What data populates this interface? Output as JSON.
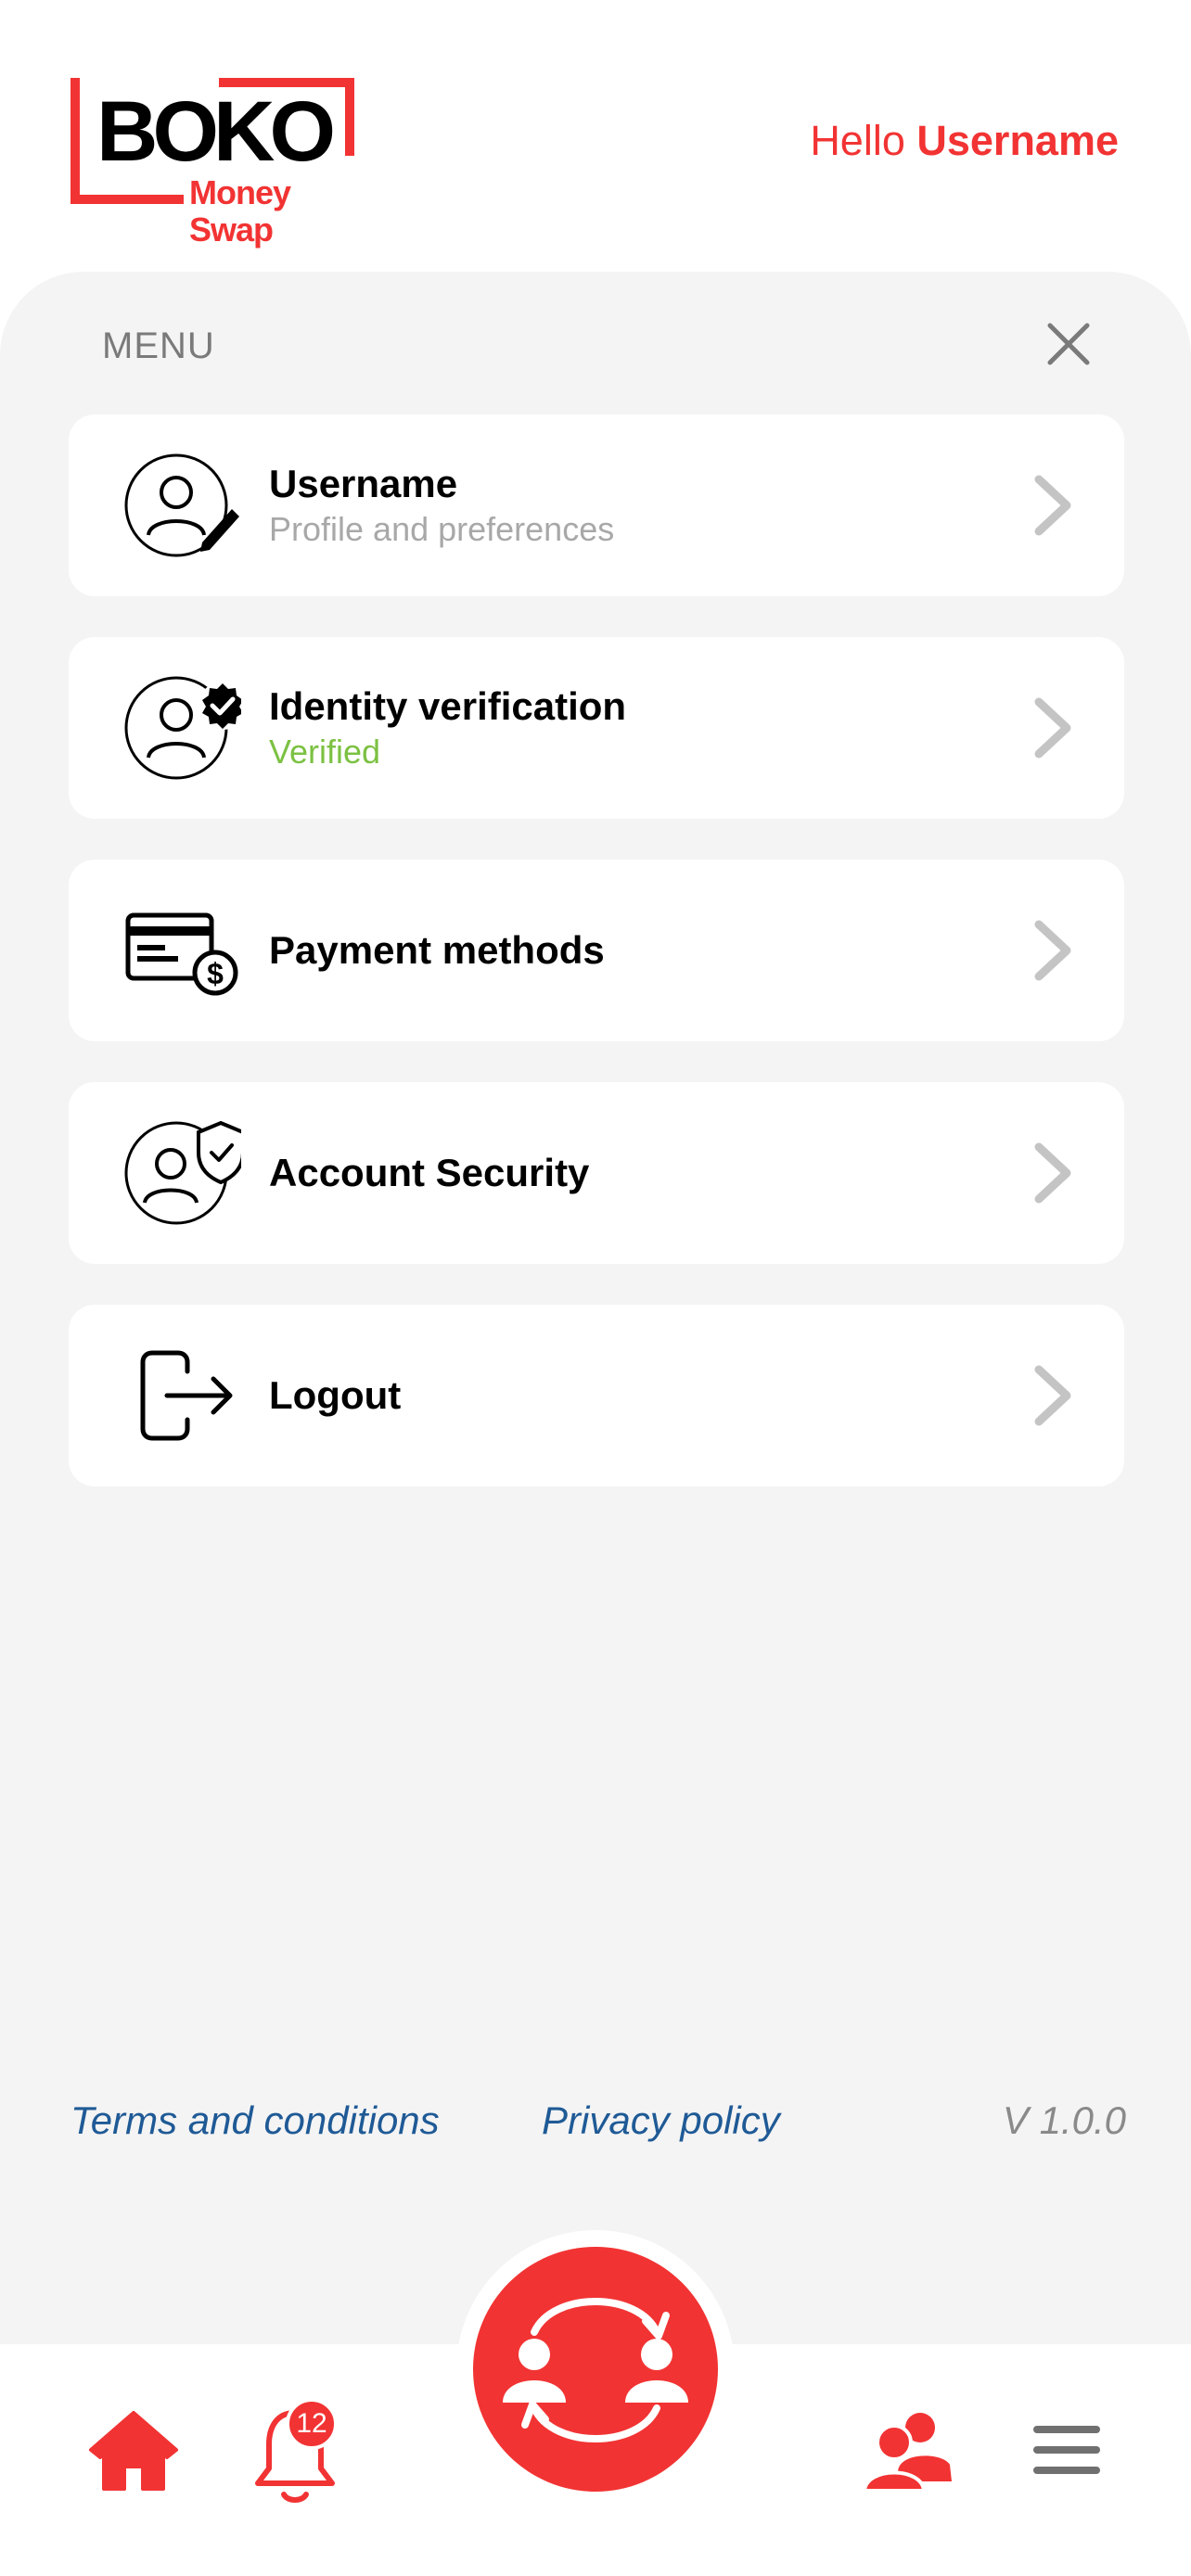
{
  "header": {
    "logo_text": "BOKO",
    "logo_sub": "Money Swap",
    "greeting_prefix": "Hello ",
    "greeting_name": "Username"
  },
  "menu": {
    "title": "MENU",
    "items": [
      {
        "icon": "user-edit-icon",
        "title": "Username",
        "subtitle": "Profile and preferences"
      },
      {
        "icon": "user-verified-icon",
        "title": "Identity verification",
        "subtitle": "Verified"
      },
      {
        "icon": "payment-card-icon",
        "title": "Payment methods"
      },
      {
        "icon": "user-shield-icon",
        "title": "Account Security"
      },
      {
        "icon": "logout-icon",
        "title": "Logout"
      }
    ]
  },
  "footer": {
    "terms": "Terms and conditions",
    "privacy": "Privacy policy",
    "version": "V 1.0.0"
  },
  "nav": {
    "notification_count": "12"
  },
  "colors": {
    "brand_red": "#f23333",
    "verified_green": "#7cc142",
    "link_blue": "#1f5a96",
    "panel_bg": "#f4f4f4"
  }
}
